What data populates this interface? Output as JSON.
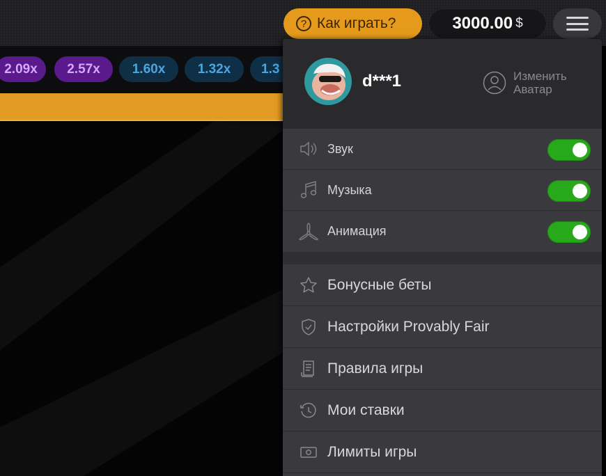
{
  "header": {
    "how_to_play_label": "Как играть?",
    "how_to_play_glyph": "?",
    "balance_value": "3000.00",
    "currency_symbol": "$",
    "menu_icon": "hamburger-icon",
    "colors": {
      "accent_orange": "#e59a1b",
      "toggle_green": "#27a91b"
    }
  },
  "multipliers": [
    {
      "value": "2.09x",
      "color": "purple"
    },
    {
      "value": "2.57x",
      "color": "purple"
    },
    {
      "value": "1.60x",
      "color": "blue"
    },
    {
      "value": "1.32x",
      "color": "blue"
    },
    {
      "value": "1.3",
      "color": "blue"
    }
  ],
  "menu": {
    "profile": {
      "username": "d***1",
      "change_avatar_label": "Изменить Аватар",
      "avatar_icon": "pilot-avatar",
      "change_avatar_icon": "user-icon"
    },
    "toggles": [
      {
        "label": "Звук",
        "icon": "speaker-icon",
        "enabled": true
      },
      {
        "label": "Музыка",
        "icon": "music-note-icon",
        "enabled": true
      },
      {
        "label": "Анимация",
        "icon": "propeller-icon",
        "enabled": true
      }
    ],
    "items": [
      {
        "label": "Бонусные беты",
        "icon": "star-icon"
      },
      {
        "label": "Настройки Provably Fair",
        "icon": "shield-check-icon"
      },
      {
        "label": "Правила игры",
        "icon": "document-icon"
      },
      {
        "label": "Мои ставки",
        "icon": "history-icon"
      },
      {
        "label": "Лимиты игры",
        "icon": "banknote-icon"
      }
    ]
  }
}
